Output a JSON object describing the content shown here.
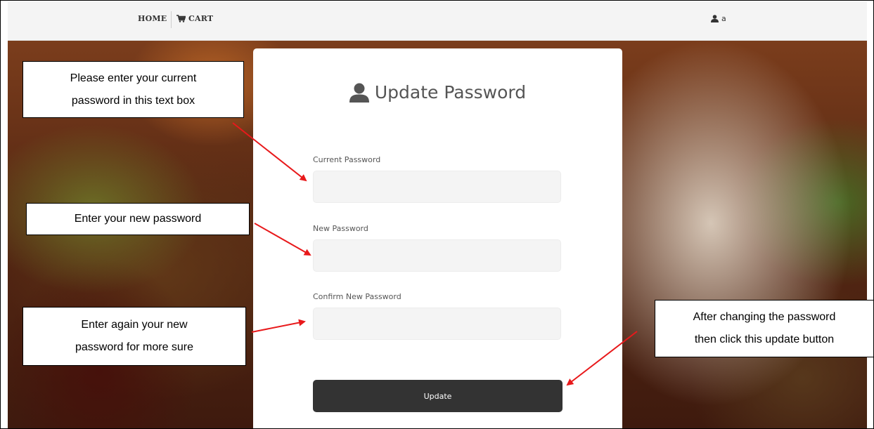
{
  "navbar": {
    "home_label": "HOME",
    "cart_label": "CART",
    "user_name": "a"
  },
  "card": {
    "title": "Update Password",
    "fields": [
      {
        "label": "Current Password",
        "value": "",
        "placeholder": ""
      },
      {
        "label": "New Password",
        "value": "",
        "placeholder": ""
      },
      {
        "label": "Confirm New Password",
        "value": "",
        "placeholder": ""
      }
    ],
    "update_label": "Update"
  },
  "callouts": {
    "current": "Please enter your current\npassword in this text box",
    "new": "Enter your new password",
    "confirm": "Enter again your new\npassword for more sure",
    "update": "After changing the password\nthen click this update button"
  },
  "colors": {
    "arrow": "#e8191b",
    "button_bg": "#333333",
    "navbar_bg": "#f4f4f4",
    "input_bg": "#f4f4f4"
  },
  "icons": {
    "cart": "cart-icon",
    "user": "user-icon",
    "title": "user-icon"
  }
}
